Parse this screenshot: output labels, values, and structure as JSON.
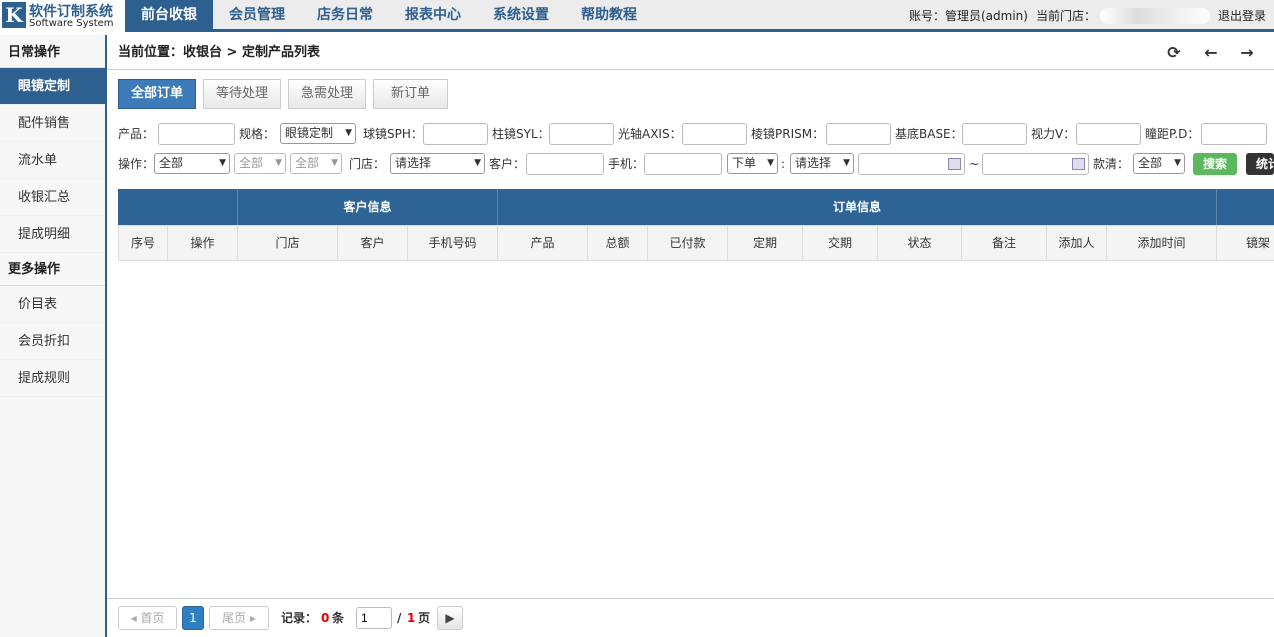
{
  "logo": {
    "letter": "K",
    "title": "软件订制系统",
    "subtitle": "Software System"
  },
  "nav": [
    "前台收银",
    "会员管理",
    "店务日常",
    "报表中心",
    "系统设置",
    "帮助教程"
  ],
  "account": {
    "label": "账号：管理员(admin)",
    "store_label": "当前门店：",
    "logout": "退出登录"
  },
  "sidebar": {
    "section1": "日常操作",
    "items1": [
      "眼镜定制",
      "配件销售",
      "流水单",
      "收银汇总",
      "提成明细"
    ],
    "section2": "更多操作",
    "items2": [
      "价目表",
      "会员折扣",
      "提成规则"
    ]
  },
  "breadcrumb": "当前位置：收银台 > 定制产品列表",
  "tabs": [
    "全部订单",
    "等待处理",
    "急需处理",
    "新订单"
  ],
  "filters1": {
    "product": "产品：",
    "spec": "规格：",
    "spec_value": "眼镜定制",
    "sph": "球镜SPH：",
    "syl": "柱镜SYL：",
    "axis": "光轴AXIS：",
    "prism": "棱镜PRISM：",
    "base": "基底BASE：",
    "vision": "视力V：",
    "pd": "瞳距P.D："
  },
  "filters2": {
    "op": "操作：",
    "op_value": "全部",
    "op2_value": "全部",
    "op3_value": "全部",
    "store": "门店：",
    "store_value": "请选择",
    "customer": "客户：",
    "phone": "手机：",
    "order_value": "下单",
    "choose_value": "请选择",
    "tilde": "~",
    "payment": "款清：",
    "payment_value": "全部",
    "search": "搜索",
    "stats": "统计"
  },
  "table": {
    "groups": [
      "客户信息",
      "订单信息"
    ],
    "columns": [
      "序号",
      "操作",
      "门店",
      "客户",
      "手机号码",
      "产品",
      "总额",
      "已付款",
      "定期",
      "交期",
      "状态",
      "备注",
      "添加人",
      "添加时间",
      "镜架"
    ]
  },
  "pager": {
    "first": "首页",
    "page": "1",
    "last": "尾页",
    "records": "记录：",
    "count": "0",
    "unit": "条",
    "current": "1",
    "slash": "/",
    "total": "1",
    "pages": "页"
  },
  "colors": {
    "primary": "#2d5f8f",
    "green": "#5cb85c",
    "red": "#e60000"
  }
}
